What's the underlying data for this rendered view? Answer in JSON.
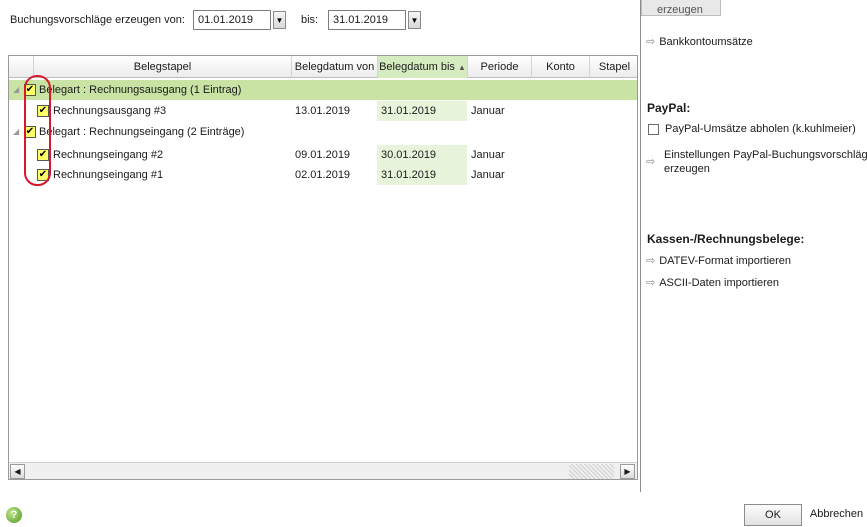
{
  "filter": {
    "from_label": "Buchungsvorschläge erzeugen von:",
    "from_value": "01.01.2019",
    "to_label": "bis:",
    "to_value": "31.01.2019"
  },
  "grid": {
    "columns": [
      "Belegstapel",
      "Belegdatum von",
      "Belegdatum bis",
      "Periode",
      "Konto",
      "Stapel"
    ],
    "sorted_column": "Belegdatum bis",
    "sort_indicator": "▲",
    "groups": [
      {
        "label": "Belegart : Rechnungsausgang (1 Eintrag)",
        "checked": true,
        "rows": [
          {
            "name": "Rechnungsausgang #3",
            "von": "13.01.2019",
            "bis": "31.01.2019",
            "periode": "Januar",
            "checked": true
          }
        ]
      },
      {
        "label": "Belegart : Rechnungseingang (2 Einträge)",
        "checked": true,
        "rows": [
          {
            "name": "Rechnungseingang #2",
            "von": "09.01.2019",
            "bis": "30.01.2019",
            "periode": "Januar",
            "checked": true
          },
          {
            "name": "Rechnungseingang #1",
            "von": "02.01.2019",
            "bis": "31.01.2019",
            "periode": "Januar",
            "checked": true
          }
        ]
      }
    ]
  },
  "panel": {
    "partial_text": "erzeugen",
    "bank_link": "Bankkontoumsätze",
    "paypal_title": "PayPal:",
    "paypal_checkbox": "PayPal-Umsätze abholen (k.kuhlmeier)",
    "paypal_settings_line1": "Einstellungen PayPal-Buchungsvorschläge",
    "paypal_settings_line2": "erzeugen",
    "kassen_title": "Kassen-/Rechnungsbelege:",
    "datev_link": "DATEV-Format importieren",
    "ascii_link": "ASCII-Daten importieren"
  },
  "footer": {
    "ok_label": "OK",
    "cancel_label": "Abbrechen"
  },
  "colors": {
    "group_band": "#c8e3a4",
    "sorted_header": "#d5ecc1",
    "checkbox_fill": "#ffff66",
    "annotation": "#d9182e"
  }
}
